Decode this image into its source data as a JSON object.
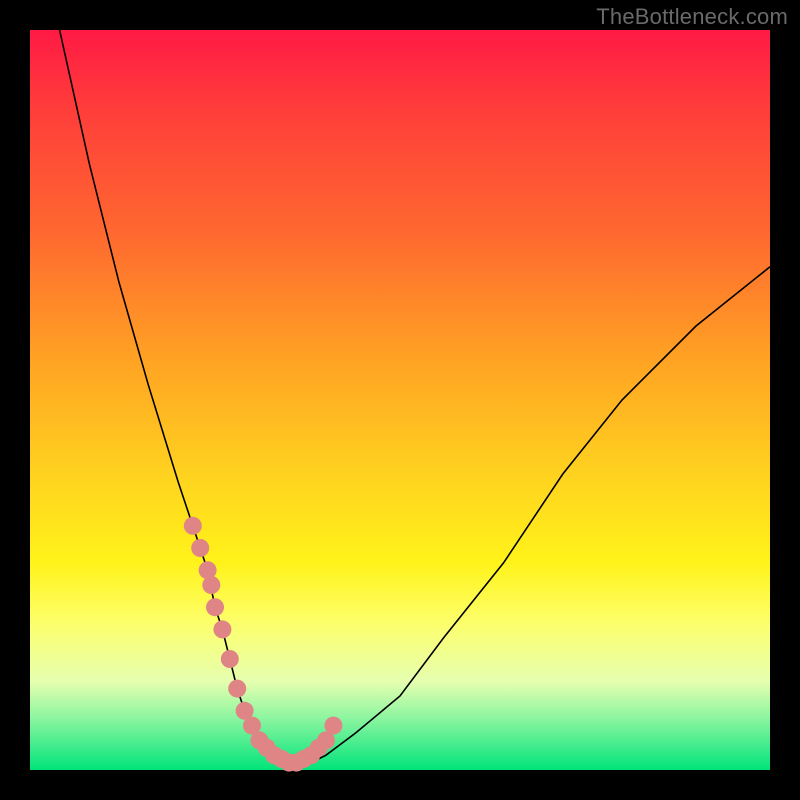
{
  "watermark": "TheBottleneck.com",
  "colors": {
    "frame": "#000000",
    "gradient_top": "#ff1a44",
    "gradient_bottom": "#00e47a",
    "curve": "#000000",
    "dots": "#e08585"
  },
  "chart_data": {
    "type": "line",
    "title": "",
    "xlabel": "",
    "ylabel": "",
    "xlim": [
      0,
      100
    ],
    "ylim": [
      0,
      100
    ],
    "grid": false,
    "series": [
      {
        "name": "bottleneck-curve",
        "x": [
          4,
          8,
          12,
          16,
          20,
          24,
          25,
          26,
          27,
          28,
          29,
          30,
          31,
          32,
          33,
          34,
          36,
          38,
          40,
          44,
          50,
          56,
          64,
          72,
          80,
          90,
          100
        ],
        "y": [
          100,
          82,
          66,
          52,
          39,
          27,
          22,
          19,
          15,
          11,
          8,
          6,
          4,
          3,
          2,
          1.5,
          1,
          1,
          2,
          5,
          10,
          18,
          28,
          40,
          50,
          60,
          68
        ]
      }
    ],
    "highlight_points": {
      "name": "marked-region",
      "x": [
        22,
        23,
        24,
        24.5,
        25,
        26,
        27,
        28,
        29,
        30,
        31,
        32,
        33,
        34,
        35,
        36,
        37,
        38,
        39,
        40,
        41
      ],
      "y": [
        33,
        30,
        27,
        25,
        22,
        19,
        15,
        11,
        8,
        6,
        4,
        3,
        2,
        1.5,
        1,
        1,
        1.5,
        2,
        3,
        4,
        6
      ]
    }
  }
}
